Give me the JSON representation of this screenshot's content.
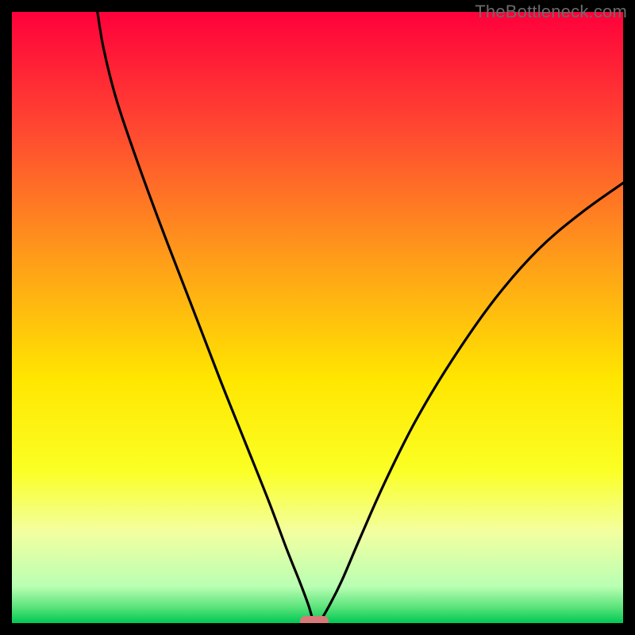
{
  "watermark": {
    "text": "TheBottleneck.com"
  },
  "chart_data": {
    "type": "line",
    "title": "",
    "xlabel": "",
    "ylabel": "",
    "xlim": [
      0,
      100
    ],
    "ylim": [
      0,
      100
    ],
    "grid": false,
    "legend": false,
    "background_gradient": {
      "stops": [
        {
          "pos": 0.0,
          "color": "#ff003b"
        },
        {
          "pos": 0.2,
          "color": "#ff4b30"
        },
        {
          "pos": 0.4,
          "color": "#ff9b1a"
        },
        {
          "pos": 0.6,
          "color": "#ffe600"
        },
        {
          "pos": 0.75,
          "color": "#fbff24"
        },
        {
          "pos": 0.85,
          "color": "#f3ffa0"
        },
        {
          "pos": 0.94,
          "color": "#b9ffb3"
        },
        {
          "pos": 0.975,
          "color": "#58e27a"
        },
        {
          "pos": 1.0,
          "color": "#00c853"
        }
      ]
    },
    "series": [
      {
        "name": "curve",
        "color": "#000000",
        "x": [
          14.0,
          15.0,
          17.0,
          20.0,
          24.0,
          29.0,
          34.0,
          38.0,
          42.0,
          45.0,
          47.0,
          48.5,
          49.5,
          50.5,
          52.0,
          54.0,
          57.0,
          61.0,
          66.0,
          72.0,
          79.0,
          86.0,
          93.0,
          100.0
        ],
        "y": [
          100.0,
          94.0,
          86.0,
          77.0,
          66.0,
          53.0,
          40.0,
          30.0,
          20.0,
          12.0,
          7.0,
          3.0,
          0.0,
          0.5,
          3.0,
          7.0,
          14.0,
          23.0,
          33.0,
          43.0,
          53.0,
          61.0,
          67.0,
          72.0
        ]
      }
    ],
    "marker": {
      "x": 49.5,
      "y": 0.0,
      "color": "#d97a7a"
    }
  }
}
